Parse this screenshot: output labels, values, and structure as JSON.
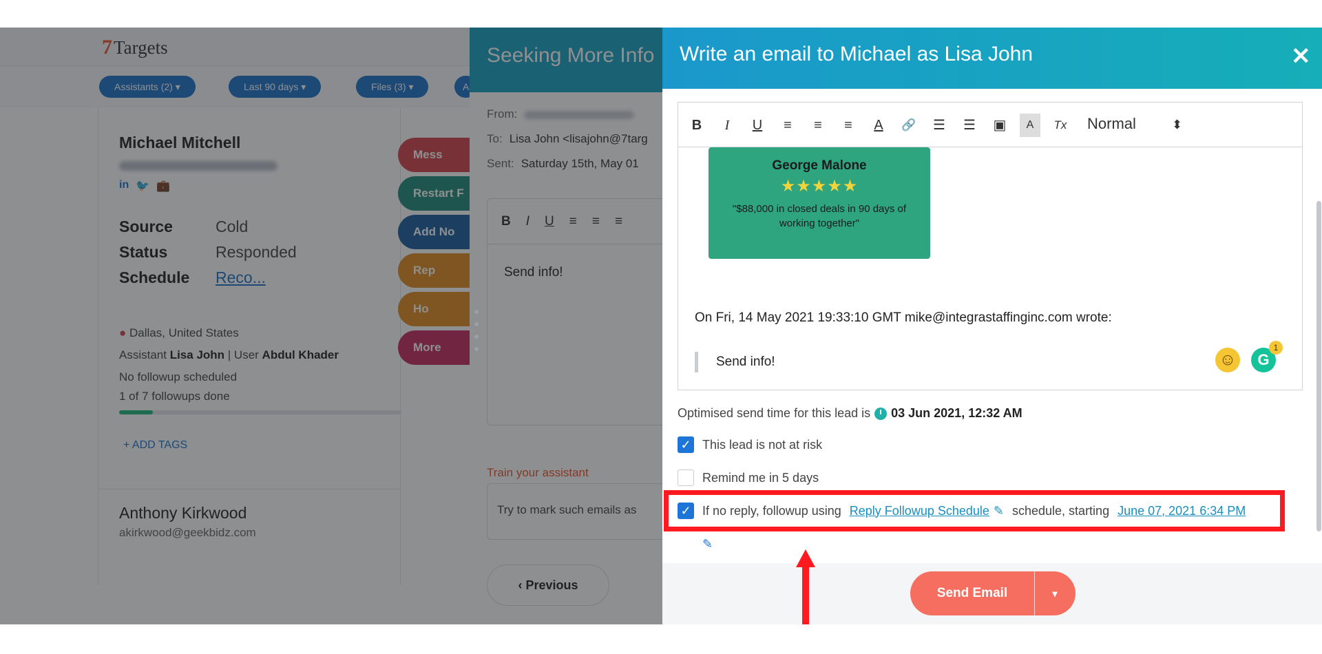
{
  "app": {
    "logo_mark": "7",
    "logo_text": "Targets",
    "filters": [
      {
        "label": "Assistants (2) ▾"
      },
      {
        "label": "Last 90 days ▾"
      },
      {
        "label": "Files (3) ▾"
      },
      {
        "label": "A"
      }
    ],
    "lead": {
      "name": "Michael Mitchell",
      "social": [
        "in",
        "🐦",
        "💼"
      ],
      "fields": [
        {
          "key": "Source",
          "value": "Cold"
        },
        {
          "key": "Status",
          "value": "Responded"
        },
        {
          "key": "Schedule",
          "value": "Reco..."
        }
      ],
      "location": "Dallas, United States",
      "assistant_prefix": "Assistant ",
      "assistant": "Lisa John",
      "user_prefix": " | User ",
      "user": "Abdul Khader",
      "followup_status": "No followup scheduled",
      "followups_done": "1 of 7 followups done",
      "progress": 0.12,
      "add_tags": "+ ADD TAGS"
    },
    "lead2": {
      "name": "Anthony Kirkwood",
      "email": "akirkwood@geekbidz.com"
    },
    "side_buttons": [
      {
        "label": "Mess",
        "color": "#d2444a"
      },
      {
        "label": "Restart F",
        "color": "#1e8c7a"
      },
      {
        "label": "Add No",
        "color": "#1a5f9e"
      },
      {
        "label": "Rep",
        "color": "#e08a1e"
      },
      {
        "label": "Ho",
        "color": "#e08a1e"
      },
      {
        "label": "More",
        "color": "#c62a5f"
      }
    ]
  },
  "panel2": {
    "title": "Seeking More Info",
    "from_label": "From:",
    "to_label": "To:",
    "to_value": "Lisa John <lisajohn@7targ",
    "sent_label": "Sent:",
    "sent_value": "Saturday 15th, May 01",
    "toolbar": [
      "B",
      "I",
      "U",
      "≡",
      "≡",
      "≡"
    ],
    "body": "Send info!",
    "train_label": "Train your assistant",
    "train_placeholder": "Try to mark such emails as",
    "previous": "Previous"
  },
  "modal": {
    "title": "Write an email to Michael as Lisa John",
    "close": "✕",
    "toolbar": {
      "bold": "B",
      "italic": "I",
      "underline": "U",
      "align_left": "≡",
      "align_center": "≡",
      "align_right": "≡",
      "text_color": "A",
      "link": "🔗",
      "ordered_list": "☰",
      "bullet_list": "☰",
      "image": "▣",
      "highlight": "A",
      "clear": "Tx",
      "format": "Normal",
      "format_caret": "⬍"
    },
    "card": {
      "name": "George Malone",
      "stars": "★★★★★",
      "quote": "\"$88,000 in closed deals in 90 days of working together\""
    },
    "wrote_line": "On Fri, 14 May 2021 19:33:10 GMT mike@integrastaffinginc.com wrote:",
    "quoted": "Send info!",
    "emoji": "☺",
    "grammarly": "G",
    "grammarly_count": "1",
    "optimised_prefix": "Optimised send time for this lead is",
    "optimised_time": "03 Jun 2021, 12:32 AM",
    "options": {
      "not_at_risk": {
        "label": "This lead is not at risk",
        "checked": true
      },
      "remind": {
        "label": "Remind me in 5 days",
        "checked": false
      },
      "followup": {
        "checked": true,
        "prefix": "If no reply, followup using",
        "schedule": "Reply Followup Schedule",
        "middle": "schedule, starting",
        "start": "June 07, 2021 6:34 PM"
      }
    },
    "send": "Send Email",
    "send_caret": "▾"
  },
  "colors": {
    "accent": "#1a98cb",
    "highlight": "#ff1a1f",
    "send": "#f56e5f",
    "checkbox": "#1d75d8"
  }
}
